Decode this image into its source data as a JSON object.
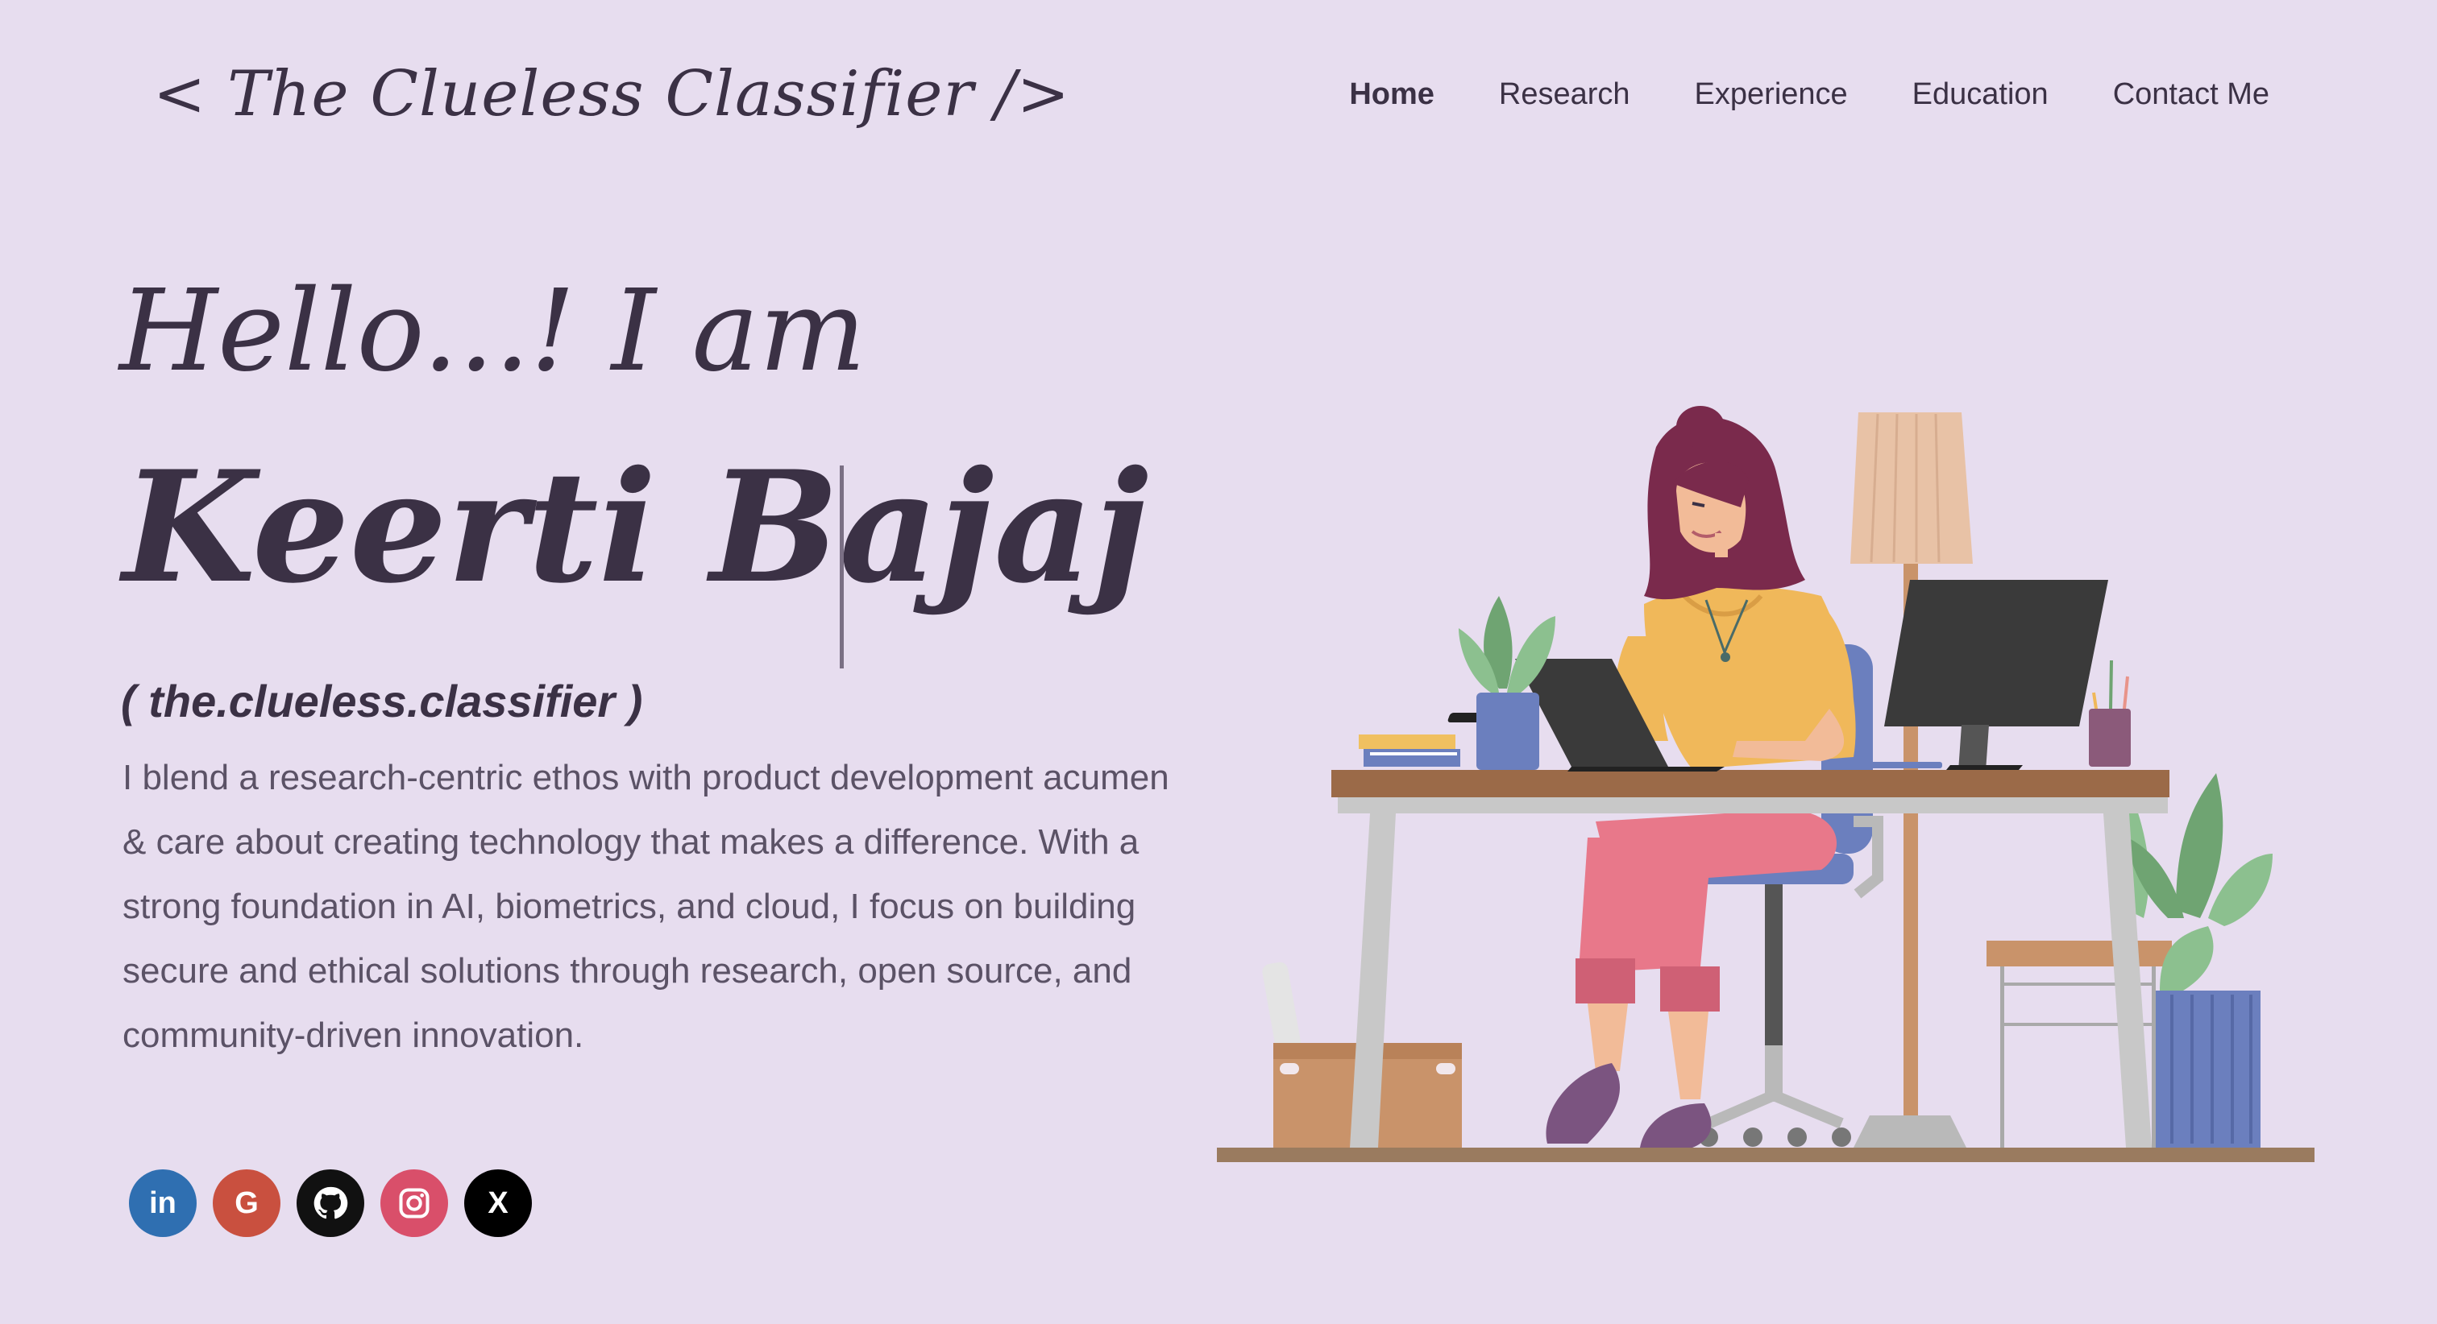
{
  "header": {
    "brand": "< The Clueless Classifier />",
    "nav": [
      {
        "label": "Home"
      },
      {
        "label": "Research"
      },
      {
        "label": "Experience"
      },
      {
        "label": "Education"
      },
      {
        "label": "Contact Me"
      }
    ]
  },
  "hero": {
    "greeting": "Hello...! I am",
    "name": "Keerti Bajaj",
    "handle": "( the.clueless.classifier )",
    "bio": "I blend a research-centric ethos with product development acumen & care about creating technology that makes a difference. With a strong foundation in AI, biometrics, and cloud, I focus on building secure and ethical solutions through research, open source, and community-driven innovation."
  },
  "socials": [
    {
      "name": "linkedin-icon",
      "glyph": "in",
      "color": "#2f6fb1"
    },
    {
      "name": "google-icon",
      "glyph": "G",
      "color": "#c9503f"
    },
    {
      "name": "github-icon",
      "glyph": "",
      "color": "#111111"
    },
    {
      "name": "instagram-icon",
      "glyph": "",
      "color": "#d94f6a"
    },
    {
      "name": "x-icon",
      "glyph": "X",
      "color": "#000000"
    }
  ],
  "colors": {
    "background": "#e7ddef",
    "text": "#3b3145",
    "body_text": "#5b5266"
  }
}
